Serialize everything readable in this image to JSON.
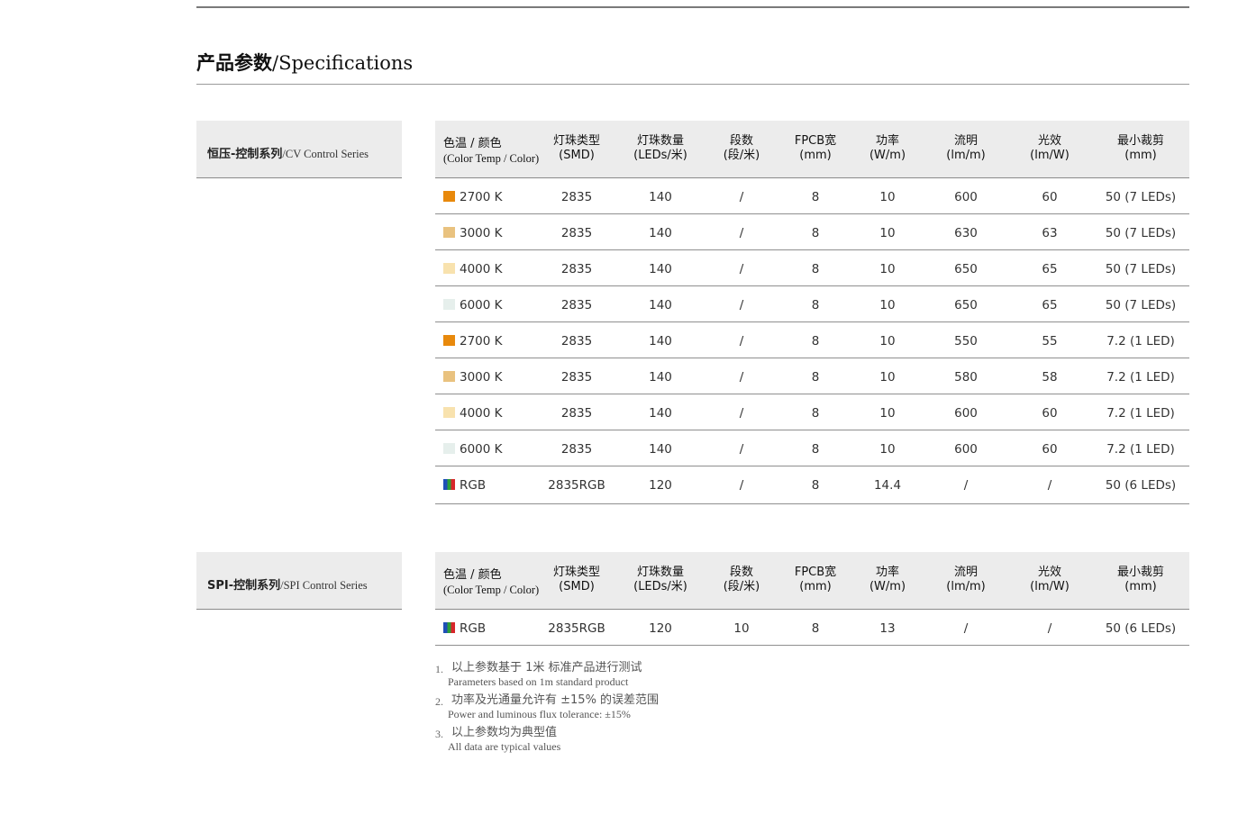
{
  "header": {
    "title_zh": "产品参数",
    "title_en": "/Specifications"
  },
  "columns": [
    {
      "l1": "色温 / 颜色",
      "l2": "(Color Temp / Color)"
    },
    {
      "l1": "灯珠类型",
      "l2": "(SMD)"
    },
    {
      "l1": "灯珠数量",
      "l2": "(LEDs/米)"
    },
    {
      "l1": "段数",
      "l2": "(段/米)"
    },
    {
      "l1": "FPCB宽",
      "l2": "(mm)"
    },
    {
      "l1": "功率",
      "l2": "(W/m)"
    },
    {
      "l1": "流明",
      "l2": "(lm/m)"
    },
    {
      "l1": "光效",
      "l2": "(lm/W)"
    },
    {
      "l1": "最小裁剪",
      "l2": "(mm)"
    }
  ],
  "cv": {
    "label_zh": "恒压-控制系列",
    "label_en": "/CV Control Series",
    "rows": [
      {
        "swatch": "#e8890c",
        "color": "2700 K",
        "smd": "2835",
        "leds": "140",
        "seg": "/",
        "fpcb": "8",
        "power": "10",
        "lumen": "600",
        "eff": "60",
        "cut": "50 (7 LEDs)"
      },
      {
        "swatch": "#e9c27f",
        "color": "3000 K",
        "smd": "2835",
        "leds": "140",
        "seg": "/",
        "fpcb": "8",
        "power": "10",
        "lumen": "630",
        "eff": "63",
        "cut": "50 (7 LEDs)"
      },
      {
        "swatch": "#f8e2ae",
        "color": "4000 K",
        "smd": "2835",
        "leds": "140",
        "seg": "/",
        "fpcb": "8",
        "power": "10",
        "lumen": "650",
        "eff": "65",
        "cut": "50 (7 LEDs)"
      },
      {
        "swatch": "#e6efec",
        "color": "6000 K",
        "smd": "2835",
        "leds": "140",
        "seg": "/",
        "fpcb": "8",
        "power": "10",
        "lumen": "650",
        "eff": "65",
        "cut": "50 (7 LEDs)"
      },
      {
        "swatch": "#e8890c",
        "color": "2700 K",
        "smd": "2835",
        "leds": "140",
        "seg": "/",
        "fpcb": "8",
        "power": "10",
        "lumen": "550",
        "eff": "55",
        "cut": "7.2 (1 LED)"
      },
      {
        "swatch": "#e9c27f",
        "color": "3000 K",
        "smd": "2835",
        "leds": "140",
        "seg": "/",
        "fpcb": "8",
        "power": "10",
        "lumen": "580",
        "eff": "58",
        "cut": "7.2 (1 LED)"
      },
      {
        "swatch": "#f8e2ae",
        "color": "4000 K",
        "smd": "2835",
        "leds": "140",
        "seg": "/",
        "fpcb": "8",
        "power": "10",
        "lumen": "600",
        "eff": "60",
        "cut": "7.2 (1 LED)"
      },
      {
        "swatch": "#e6efec",
        "color": "6000 K",
        "smd": "2835",
        "leds": "140",
        "seg": "/",
        "fpcb": "8",
        "power": "10",
        "lumen": "600",
        "eff": "60",
        "cut": "7.2 (1 LED)"
      },
      {
        "swatch": "rgb",
        "color": "RGB",
        "smd": "2835RGB",
        "leds": "120",
        "seg": "/",
        "fpcb": "8",
        "power": "14.4",
        "lumen": "/",
        "eff": "/",
        "cut": "50 (6 LEDs)"
      }
    ]
  },
  "spi": {
    "label_zh": "SPI-控制系列",
    "label_en": "/SPI Control Series",
    "rows": [
      {
        "swatch": "rgb",
        "color": "RGB",
        "smd": "2835RGB",
        "leds": "120",
        "seg": "10",
        "fpcb": "8",
        "power": "13",
        "lumen": "/",
        "eff": "/",
        "cut": "50 (6 LEDs)"
      }
    ]
  },
  "notes": [
    {
      "num": "1.",
      "zh": "以上参数基于 1米 标准产品进行测试",
      "en": "Parameters based on 1m standard product"
    },
    {
      "num": "2.",
      "zh": "功率及光通量允许有 ±15% 的误差范围",
      "en": "Power and luminous flux tolerance: ±15%"
    },
    {
      "num": "3.",
      "zh": "以上参数均为典型值",
      "en": "All data are typical values"
    }
  ]
}
